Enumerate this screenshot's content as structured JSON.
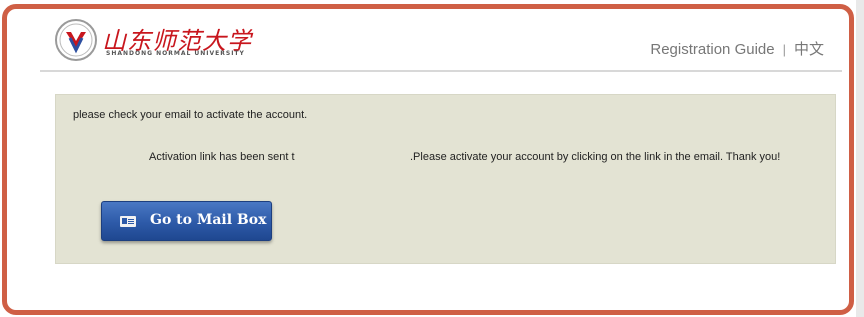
{
  "header": {
    "logo_text_cn": "山东师范大学",
    "logo_text_en": "SHANDONG NORMAL UNIVERSITY",
    "nav_registration_guide": "Registration Guide",
    "nav_separator": "|",
    "nav_language": "中文"
  },
  "main": {
    "message_line": "please check your email to activate the account.",
    "activation_prefix": "Activation link has been sent t",
    "activation_suffix": ".Please activate your account by clicking on the link in the email. Thank you!",
    "mail_button_label": "Go to Mail Box",
    "mail_button_icon": "mail-card-icon"
  },
  "colors": {
    "frame_border": "#cf5f45",
    "panel_bg": "#e3e3d3",
    "button_bg": "#2d5aa8",
    "logo_red": "#c8161d"
  }
}
